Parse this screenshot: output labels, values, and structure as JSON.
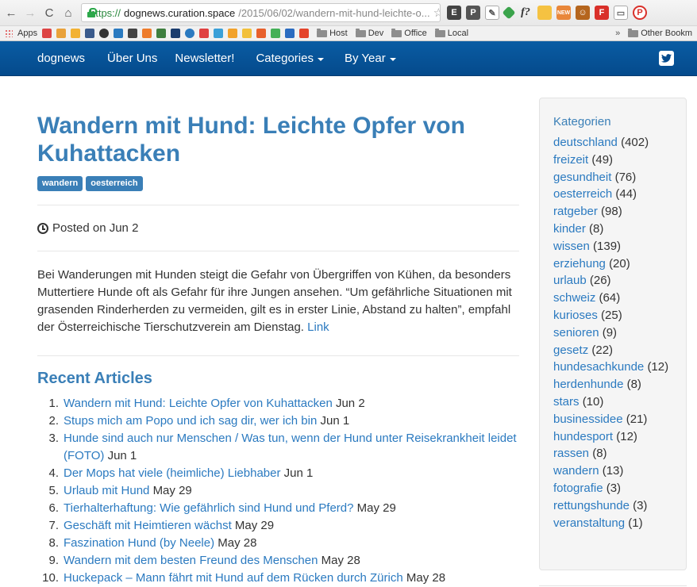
{
  "browser": {
    "url_scheme": "https://",
    "url_host": "dognews.curation.space",
    "url_path": "/2015/06/02/wandern-mit-hund-leichte-o...",
    "extension_labels": [
      "f?",
      "NEW"
    ],
    "bookmarks": {
      "apps_label": "Apps",
      "folders": [
        "Host",
        "Dev",
        "Office",
        "Local"
      ],
      "more": "»",
      "other": "Other Bookm"
    }
  },
  "navbar": {
    "brand": "dognews",
    "items": [
      "Über Uns",
      "Newsletter!"
    ],
    "dropdowns": [
      "Categories",
      "By Year"
    ]
  },
  "article": {
    "title": "Wandern mit Hund: Leichte Opfer von Kuhattacken",
    "tags": [
      "wandern",
      "oesterreich"
    ],
    "posted": "Posted on Jun 2",
    "body": "Bei Wanderungen mit Hunden steigt die Gefahr von Übergriffen von Kühen, da besonders Muttertiere Hunde oft als Gefahr für ihre Jungen ansehen. “Um gefährliche Situationen mit grasenden Rinderherden zu vermeiden, gilt es in erster Linie, Abstand zu halten”, empfahl der Österreichische Tierschutzverein am Dienstag.",
    "link": "Link"
  },
  "recent": {
    "title": "Recent Articles",
    "items": [
      {
        "n": "1.",
        "title": "Wandern mit Hund: Leichte Opfer von Kuhattacken",
        "date": "Jun 2"
      },
      {
        "n": "2.",
        "title": "Stups mich am Popo und ich sag dir, wer ich bin",
        "date": "Jun 1"
      },
      {
        "n": "3.",
        "title": "Hunde sind auch nur Menschen / Was tun, wenn der Hund unter Reisekrankheit leidet (FOTO)",
        "date": "Jun 1"
      },
      {
        "n": "4.",
        "title": "Der Mops hat viele (heimliche) Liebhaber",
        "date": "Jun 1"
      },
      {
        "n": "5.",
        "title": "Urlaub mit Hund",
        "date": "May 29"
      },
      {
        "n": "6.",
        "title": "Tierhalterhaftung: Wie gefährlich sind Hund und Pferd?",
        "date": "May 29"
      },
      {
        "n": "7.",
        "title": "Geschäft mit Heimtieren wächst",
        "date": "May 29"
      },
      {
        "n": "8.",
        "title": "Faszination Hund (by Neele)",
        "date": "May 28"
      },
      {
        "n": "9.",
        "title": "Wandern mit dem besten Freund des Menschen",
        "date": "May 28"
      },
      {
        "n": "10.",
        "title": "Huckepack – Mann fährt mit Hund auf dem Rücken durch Zürich",
        "date": "May 28"
      }
    ]
  },
  "sidebar": {
    "title": "Kategorien",
    "categories": [
      {
        "name": "deutschland",
        "count": "(402)"
      },
      {
        "name": "freizeit",
        "count": "(49)"
      },
      {
        "name": "gesundheit",
        "count": "(76)"
      },
      {
        "name": "oesterreich",
        "count": "(44)"
      },
      {
        "name": "ratgeber",
        "count": "(98)"
      },
      {
        "name": "kinder",
        "count": "(8)"
      },
      {
        "name": "wissen",
        "count": "(139)"
      },
      {
        "name": "erziehung",
        "count": "(20)"
      },
      {
        "name": "urlaub",
        "count": "(26)"
      },
      {
        "name": "schweiz",
        "count": "(64)"
      },
      {
        "name": "kurioses",
        "count": "(25)"
      },
      {
        "name": "senioren",
        "count": "(9)"
      },
      {
        "name": "gesetz",
        "count": "(22)"
      },
      {
        "name": "hundesachkunde",
        "count": "(12)"
      },
      {
        "name": "herdenhunde",
        "count": "(8)"
      },
      {
        "name": "stars",
        "count": "(10)"
      },
      {
        "name": "businessidee",
        "count": "(21)"
      },
      {
        "name": "hundesport",
        "count": "(12)"
      },
      {
        "name": "rassen",
        "count": "(8)"
      },
      {
        "name": "wandern",
        "count": "(13)"
      },
      {
        "name": "fotografie",
        "count": "(3)"
      },
      {
        "name": "rettungshunde",
        "count": "(3)"
      },
      {
        "name": "veranstaltung",
        "count": "(1)"
      }
    ]
  },
  "colors": {
    "navbar": "#0a5ca3",
    "heading": "#3a7fb7",
    "link": "#2b7ac0",
    "tag": "#3a7fb7"
  }
}
